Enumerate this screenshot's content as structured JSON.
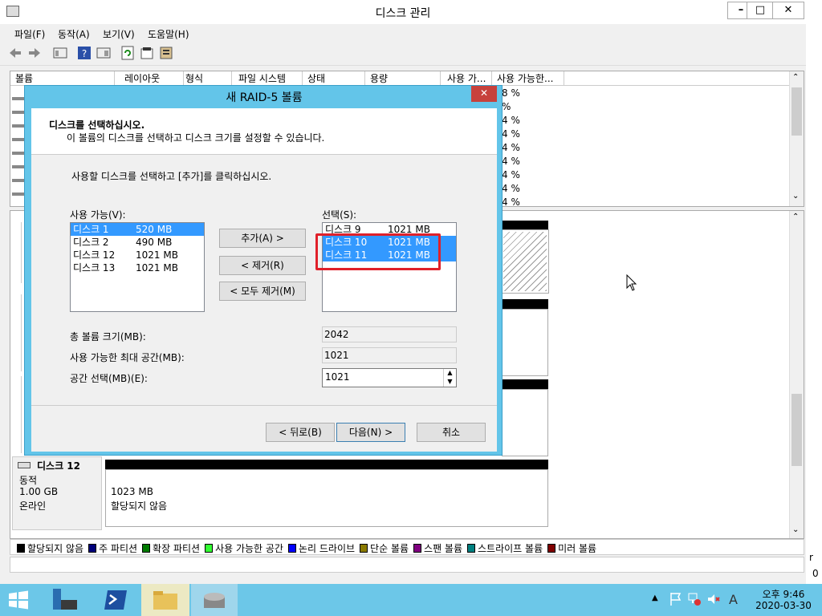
{
  "main": {
    "title": "디스크 관리",
    "win_min": "–",
    "win_max": "□",
    "win_close": "✕",
    "menus": [
      "파일(F)",
      "동작(A)",
      "보기(V)",
      "도움말(H)"
    ],
    "columns": [
      "볼륨",
      "레이아웃",
      "형식",
      "파일 시스템",
      "상태",
      "용량",
      "사용 가...",
      "사용 가능한..."
    ],
    "pct_rows": [
      "8 %",
      "%",
      "4 %",
      "4 %",
      "4 %",
      "4 %",
      "4 %",
      "4 %",
      "4 %"
    ],
    "disk12": {
      "name": "디스크 12",
      "type": "동적",
      "size": "1.00 GB",
      "status": "온라인",
      "part_size": "1023 MB",
      "part_status": "할당되지 않음"
    },
    "legend": [
      {
        "label": "할당되지 않음",
        "color": "#000000"
      },
      {
        "label": "주 파티션",
        "color": "#00007a"
      },
      {
        "label": "확장 파티션",
        "color": "#007a00"
      },
      {
        "label": "사용 가능한 공간",
        "color": "#33ff33"
      },
      {
        "label": "논리 드라이브",
        "color": "#0000ff"
      },
      {
        "label": "단순 볼륨",
        "color": "#8a7a00"
      },
      {
        "label": "스팬 볼륨",
        "color": "#800080"
      },
      {
        "label": "스트라이프 볼륨",
        "color": "#008080"
      },
      {
        "label": "미러 볼륨",
        "color": "#800000"
      }
    ],
    "cut_letter": "r",
    "cut_digit": "0"
  },
  "dialog": {
    "title": "새 RAID-5 볼륨",
    "close": "✕",
    "heading": "디스크를 선택하십시오.",
    "subheading": "이 볼륨의 디스크를 선택하고 디스크 크기를 설정할 수 있습니다.",
    "instruction": "사용할 디스크를 선택하고 [추가]를 클릭하십시오.",
    "available_label": "사용 가능(V):",
    "selected_label": "선택(S):",
    "available": [
      {
        "name": "디스크 1",
        "size": "520 MB",
        "selected": true
      },
      {
        "name": "디스크 2",
        "size": "490 MB",
        "selected": false
      },
      {
        "name": "디스크 12",
        "size": "1021 MB",
        "selected": false
      },
      {
        "name": "디스크 13",
        "size": "1021 MB",
        "selected": false
      }
    ],
    "selected": [
      {
        "name": "디스크 9",
        "size": "1021 MB",
        "selected": false
      },
      {
        "name": "디스크 10",
        "size": "1021 MB",
        "selected": true
      },
      {
        "name": "디스크 11",
        "size": "1021 MB",
        "selected": true
      }
    ],
    "add_btn": "추가(A) >",
    "remove_btn": "< 제거(R)",
    "remove_all_btn": "< 모두 제거(M)",
    "total_label": "총 볼륨 크기(MB):",
    "total_value": "2042",
    "max_label": "사용 가능한 최대 공간(MB):",
    "max_value": "1021",
    "space_label": "공간 선택(MB)(E):",
    "space_value": "1021",
    "back_btn": "< 뒤로(B)",
    "next_btn": "다음(N) >",
    "cancel_btn": "취소",
    "highlight_color": "#e0202a"
  },
  "taskbar": {
    "time": "오후 9:46",
    "date": "2020-03-30",
    "ime": "A"
  }
}
